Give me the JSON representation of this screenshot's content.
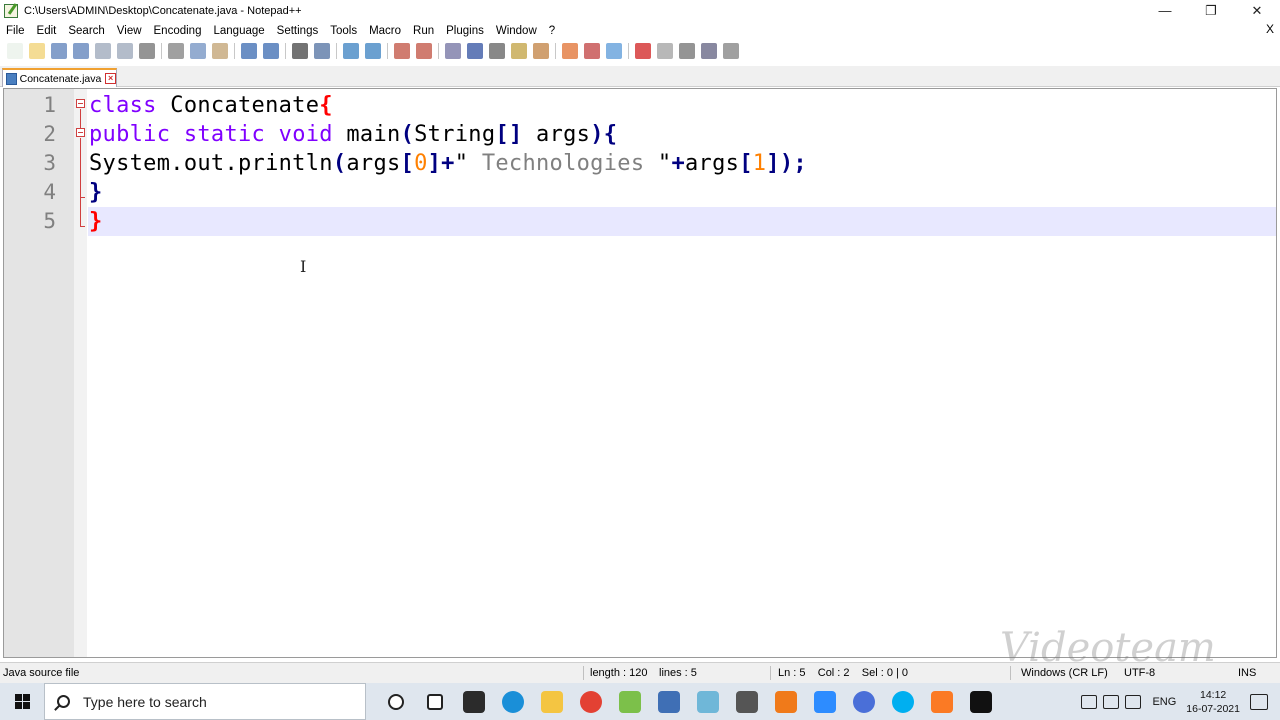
{
  "window": {
    "title": "C:\\Users\\ADMIN\\Desktop\\Concatenate.java - Notepad++",
    "controls": {
      "minimize": "—",
      "restore": "❐",
      "close": "✕"
    }
  },
  "menu": {
    "items": [
      "File",
      "Edit",
      "Search",
      "View",
      "Encoding",
      "Language",
      "Settings",
      "Tools",
      "Macro",
      "Run",
      "Plugins",
      "Window",
      "?"
    ],
    "close": "X"
  },
  "toolbar": {
    "icons": [
      "new-file-icon",
      "open-file-icon",
      "save-icon",
      "save-all-icon",
      "close-icon",
      "close-all-icon",
      "print-icon",
      "cut-icon",
      "copy-icon",
      "paste-icon",
      "undo-icon",
      "redo-icon",
      "find-icon",
      "replace-icon",
      "zoom-in-icon",
      "zoom-out-icon",
      "sync-vertical-icon",
      "sync-horizontal-icon",
      "word-wrap-icon",
      "show-all-chars-icon",
      "indent-guide-icon",
      "doc-map-icon",
      "function-list-icon",
      "folder-workspace-icon",
      "doc-switcher-icon",
      "monitor-icon",
      "record-macro-icon",
      "stop-record-icon",
      "play-macro-icon",
      "run-macro-multiple-icon",
      "save-macro-icon"
    ]
  },
  "tab": {
    "label": "Concatenate.java"
  },
  "editor": {
    "line_numbers": [
      "1",
      "2",
      "3",
      "4",
      "5"
    ],
    "lines": [
      [
        {
          "t": "class",
          "c": "kw"
        },
        {
          "t": " Concatenate",
          "c": "txt"
        },
        {
          "t": "{",
          "c": "br"
        }
      ],
      [
        {
          "t": "public",
          "c": "kw"
        },
        {
          "t": " ",
          "c": "txt"
        },
        {
          "t": "static",
          "c": "kw"
        },
        {
          "t": " ",
          "c": "txt"
        },
        {
          "t": "void",
          "c": "kw"
        },
        {
          "t": " main",
          "c": "txt"
        },
        {
          "t": "(",
          "c": "op"
        },
        {
          "t": "String",
          "c": "txt"
        },
        {
          "t": "[]",
          "c": "op"
        },
        {
          "t": " args",
          "c": "txt"
        },
        {
          "t": "){",
          "c": "op"
        }
      ],
      [
        {
          "t": "System.out.println",
          "c": "txt"
        },
        {
          "t": "(",
          "c": "op"
        },
        {
          "t": "args",
          "c": "txt"
        },
        {
          "t": "[",
          "c": "op"
        },
        {
          "t": "0",
          "c": "num"
        },
        {
          "t": "]+",
          "c": "op"
        },
        {
          "t": "\"",
          "c": "txt"
        },
        {
          "t": " Technologies ",
          "c": "str"
        },
        {
          "t": "\"",
          "c": "txt"
        },
        {
          "t": "+",
          "c": "op"
        },
        {
          "t": "args",
          "c": "txt"
        },
        {
          "t": "[",
          "c": "op"
        },
        {
          "t": "1",
          "c": "num"
        },
        {
          "t": "]);",
          "c": "op"
        }
      ],
      [
        {
          "t": "}",
          "c": "op"
        }
      ],
      [
        {
          "t": "}",
          "c": "br"
        }
      ]
    ]
  },
  "status": {
    "file_type": "Java source file",
    "length": "length : 120",
    "lines": "lines : 5",
    "position": "Ln : 5    Col : 2    Sel : 0 | 0",
    "eol": "Windows (CR LF)",
    "encoding": "UTF-8",
    "mode": "INS"
  },
  "taskbar": {
    "search_placeholder": "Type here to search",
    "apps": [
      {
        "name": "task-view-icon",
        "color": "#ffffff"
      },
      {
        "name": "widgets-icon",
        "color": "#ffffff"
      },
      {
        "name": "store-icon",
        "color": "#2b2b2b"
      },
      {
        "name": "edge-icon",
        "color": "#1a8fd8"
      },
      {
        "name": "file-explorer-icon",
        "color": "#f4c542"
      },
      {
        "name": "chrome-icon",
        "color": "#e34133"
      },
      {
        "name": "notepad-plus-plus-icon",
        "color": "#7cc04a"
      },
      {
        "name": "remote-desktop-icon",
        "color": "#3f6fb5"
      },
      {
        "name": "app-icon",
        "color": "#6fb7d8"
      },
      {
        "name": "camera-icon",
        "color": "#555555"
      },
      {
        "name": "recorder-icon",
        "color": "#f07a1a"
      },
      {
        "name": "zoom-icon",
        "color": "#2d8cff"
      },
      {
        "name": "circle-app-icon",
        "color": "#4a6fd8"
      },
      {
        "name": "skype-icon",
        "color": "#00aff0"
      },
      {
        "name": "xampp-icon",
        "color": "#fb7a24"
      },
      {
        "name": "terminal-icon",
        "color": "#111111"
      }
    ],
    "tray_lang": "ENG",
    "time": "14:12",
    "date": "16-07-2021"
  },
  "watermark": "Videoteam"
}
